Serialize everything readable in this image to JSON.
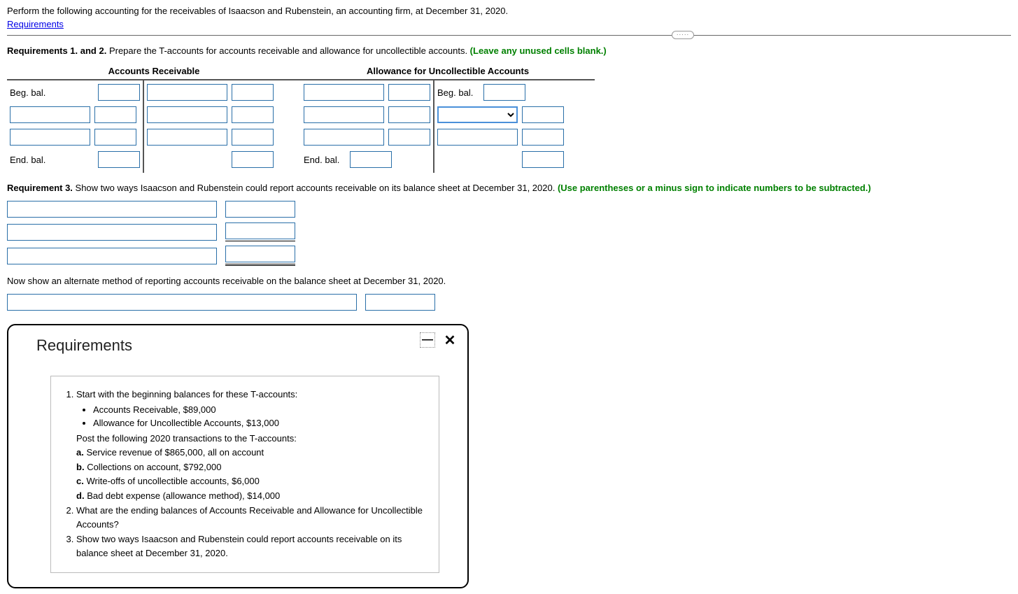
{
  "intro_text": "Perform the following accounting for the receivables of Isaacson and Rubenstein, an accounting firm, at December 31, 2020.",
  "requirements_link": "Requirements",
  "separator_handle_text": "·····",
  "req12": {
    "lead_bold": "Requirements 1. and 2.",
    "lead_rest": " Prepare the T-accounts for accounts receivable and allowance for uncollectible accounts. ",
    "lead_green": "(Leave any unused cells blank.)"
  },
  "taccounts": {
    "ar_title": "Accounts Receivable",
    "au_title": "Allowance for Uncollectible Accounts",
    "beg_bal": "Beg. bal.",
    "end_bal": "End. bal."
  },
  "req3": {
    "lead_bold": "Requirement 3.",
    "lead_rest": " Show two ways Isaacson and Rubenstein could report accounts receivable on its balance sheet at December 31, 2020. ",
    "lead_green": "(Use parentheses or a minus sign to indicate numbers to be subtracted.)"
  },
  "alt_text": "Now show an alternate method of reporting accounts receivable on the balance sheet at December 31, 2020.",
  "popup": {
    "title": "Requirements",
    "minimize": "—",
    "close": "✕",
    "item1_lead": "Start with the beginning balances for these T-accounts:",
    "item1_b1": "Accounts Receivable, $89,000",
    "item1_b2": "Allowance for Uncollectible Accounts, $13,000",
    "item1_post": "Post the following 2020 transactions to the T-accounts:",
    "item1_a": "a. Service revenue of $865,000, all on account",
    "item1_b": "b. Collections on account, $792,000",
    "item1_c": "c. Write-offs of uncollectible accounts, $6,000",
    "item1_d": "d. Bad debt expense (allowance method), $14,000",
    "item2": "What are the ending balances of Accounts Receivable and Allowance for Uncollectible Accounts?",
    "item3": "Show two ways Isaacson and Rubenstein could report accounts receivable on its balance sheet at December 31, 2020."
  }
}
